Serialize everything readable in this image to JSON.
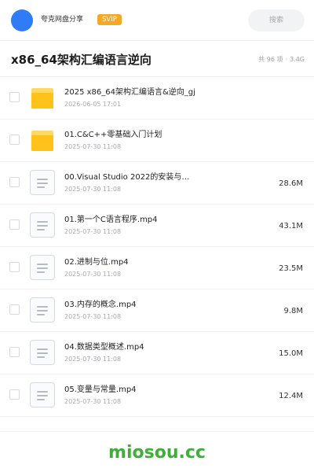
{
  "header": {
    "user_name": "夸克网盘分享",
    "badge": "SVIP",
    "search_label": "搜索",
    "avatar_color": "#2f7cf6",
    "badge_color": "#f7a823"
  },
  "folder": {
    "title": "x86_64架构汇编语言逆向",
    "item_count": "共 96 项",
    "total_size": "3.4G"
  },
  "files": [
    {
      "name": "2025 x86_64架构汇编语言&逆向_gj",
      "date": "2026-06-05 17:01",
      "size": "",
      "icon": "folder-icon"
    },
    {
      "name": "01.C&C++零基础入门计划",
      "date": "2025-07-30 11:08",
      "size": "",
      "icon": "folder-icon"
    },
    {
      "name": "00.Visual Studio 2022的安装与…",
      "date": "2025-07-30 11:08",
      "size": "28.6M",
      "icon": "file-icon"
    },
    {
      "name": "01.第一个C语言程序.mp4",
      "date": "2025-07-30 11:08",
      "size": "43.1M",
      "icon": "file-icon"
    },
    {
      "name": "02.进制与位.mp4",
      "date": "2025-07-30 11:08",
      "size": "23.5M",
      "icon": "file-icon"
    },
    {
      "name": "03.内存的概念.mp4",
      "date": "2025-07-30 11:08",
      "size": "9.8M",
      "icon": "file-icon"
    },
    {
      "name": "04.数据类型概述.mp4",
      "date": "2025-07-30 11:08",
      "size": "15.0M",
      "icon": "file-icon"
    },
    {
      "name": "05.变量与常量.mp4",
      "date": "2025-07-30 11:08",
      "size": "12.4M",
      "icon": "file-icon"
    }
  ],
  "watermark": "miosou.cc",
  "colors": {
    "folder": "#ffc21a",
    "watermark": "#3fae3a"
  }
}
